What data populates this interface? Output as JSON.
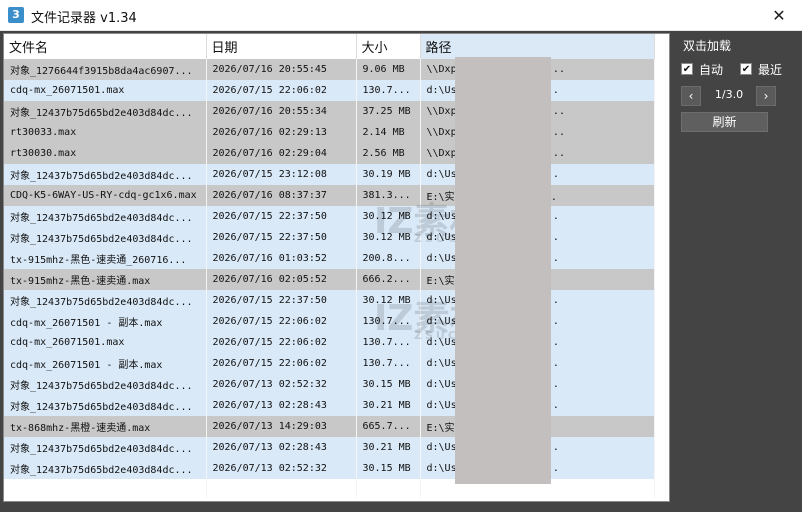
{
  "window": {
    "icon_glyph": "3",
    "title": "文件记录器 v1.34",
    "close_glyph": "✕"
  },
  "table": {
    "columns": [
      "文件名",
      "日期",
      "大小",
      "路径"
    ],
    "rows": [
      {
        "style": "gray",
        "name": "对象_1276644f3915b8da4ac6907...",
        "date": "2026/07/16 20:55:45",
        "size": "9.06 MB",
        "path": "\\\\Dxp                      ax_bm\\SU_MXK.L..."
      },
      {
        "style": "blue",
        "name": "cdq-mx_26071501.max",
        "date": "2026/07/15 22:06:02",
        "size": "130.7...",
        "path": "d:\\Us                       ments\\3ds Max..."
      },
      {
        "style": "gray",
        "name": "对象_12437b75d65bd2e403d84dc...",
        "date": "2026/07/16 20:55:34",
        "size": "37.25 MB",
        "path": "\\\\Dxp                      ax_bm\\SU_MXK.L..."
      },
      {
        "style": "gray",
        "name": "rt30033.max",
        "date": "2026/07/16 02:29:13",
        "size": "2.14 MB",
        "path": "\\\\Dxp                      ax_bm\\SU_MXK.L..."
      },
      {
        "style": "gray",
        "name": "rt30030.max",
        "date": "2026/07/16 02:29:04",
        "size": "2.56 MB",
        "path": "\\\\Dxp                      ax_bm\\SU_MXK.L..."
      },
      {
        "style": "blue",
        "name": "对象_12437b75d65bd2e403d84dc...",
        "date": "2026/07/15 23:12:08",
        "size": "30.19 MB",
        "path": "d:\\Us                       ments\\3ds Max..."
      },
      {
        "style": "gray",
        "name": "CDQ-K5-6WAY-US-RY-cdq-gc1x6.max",
        "date": "2026/07/16 08:37:37",
        "size": "381.3...",
        "path": "E:\\实                       WS-RY\\CDQ-K5-..."
      },
      {
        "style": "blue",
        "name": "对象_12437b75d65bd2e403d84dc...",
        "date": "2026/07/15 22:37:50",
        "size": "30.12 MB",
        "path": "d:\\Us                       ments\\3ds Max..."
      },
      {
        "style": "blue",
        "name": "对象_12437b75d65bd2e403d84dc...",
        "date": "2026/07/15 22:37:50",
        "size": "30.12 MB",
        "path": "d:\\Us                       ments\\3ds Max..."
      },
      {
        "style": "blue",
        "name": "tx-915mhz-黑色-速卖通_260716...",
        "date": "2026/07/16 01:03:52",
        "size": "200.8...",
        "path": "d:\\Us                       ments\\3ds Max..."
      },
      {
        "style": "gray",
        "name": "tx-915mhz-黑色-速卖通.max",
        "date": "2026/07/16 02:05:52",
        "size": "666.2...",
        "path": "E:\\实                       mhz-黑色-速卖..."
      },
      {
        "style": "blue",
        "name": "对象_12437b75d65bd2e403d84dc...",
        "date": "2026/07/15 22:37:50",
        "size": "30.12 MB",
        "path": "d:\\Us                       ments\\3ds Max..."
      },
      {
        "style": "blue",
        "name": "cdq-mx_26071501 - 副本.max",
        "date": "2026/07/15 22:06:02",
        "size": "130.7...",
        "path": "d:\\Us                       ments\\3ds Max..."
      },
      {
        "style": "blue",
        "name": "cdq-mx_26071501.max",
        "date": "2026/07/15 22:06:02",
        "size": "130.7...",
        "path": "d:\\Us                       ments\\3ds Max..."
      },
      {
        "style": "blue",
        "name": "cdq-mx_26071501 - 副本.max",
        "date": "2026/07/15 22:06:02",
        "size": "130.7...",
        "path": "d:\\Us                       ments\\3ds Max..."
      },
      {
        "style": "blue",
        "name": "对象_12437b75d65bd2e403d84dc...",
        "date": "2026/07/13 02:52:32",
        "size": "30.15 MB",
        "path": "d:\\Us                       ments\\3ds Max..."
      },
      {
        "style": "blue",
        "name": "对象_12437b75d65bd2e403d84dc...",
        "date": "2026/07/13 02:28:43",
        "size": "30.21 MB",
        "path": "d:\\Us                       ments\\3ds Max..."
      },
      {
        "style": "gray",
        "name": "tx-868mhz-黑橙-速卖通.max",
        "date": "2026/07/13 14:29:03",
        "size": "665.7...",
        "path": "E:\\实                       mhz-黑橙-速卖..."
      },
      {
        "style": "blue",
        "name": "对象_12437b75d65bd2e403d84dc...",
        "date": "2026/07/13 02:28:43",
        "size": "30.21 MB",
        "path": "d:\\Us                       ments\\3ds Max..."
      },
      {
        "style": "blue",
        "name": "对象_12437b75d65bd2e403d84dc...",
        "date": "2026/07/13 02:52:32",
        "size": "30.15 MB",
        "path": "d:\\Us                       ments\\3ds Max..."
      }
    ]
  },
  "watermark": {
    "main": "IZ素材网",
    "sub": "ZSUCAI.COM"
  },
  "side": {
    "title": "双击加载",
    "auto_label": "自动",
    "recent_label": "最近",
    "check_glyph": "✔",
    "prev_glyph": "‹",
    "next_glyph": "›",
    "page": "1/3.0",
    "refresh_label": "刷新"
  },
  "colors": {
    "background": "#444444",
    "row_gray": "#c8c8c8",
    "row_blue": "#d9e9f8",
    "sorted_header": "#dbe9f7",
    "mask": "#c3bfbe"
  },
  "icons": [
    "app-icon",
    "close-icon",
    "check-icon",
    "chevron-left-icon",
    "chevron-right-icon"
  ]
}
